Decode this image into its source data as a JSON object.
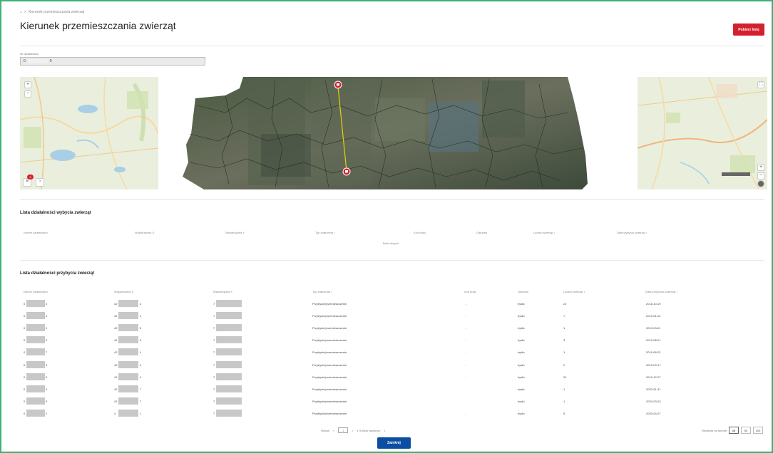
{
  "breadcrumb": {
    "home_icon": "home-icon",
    "separator": ">",
    "current": "Kierunek przemieszczania zwierząt"
  },
  "page": {
    "title": "Kierunek przemieszczania zwierząt",
    "download_label": "Pobierz listę",
    "accent": "#d4202e",
    "primary": "#0b4ea2"
  },
  "filter": {
    "label": "Nr działalności",
    "value_prefix": "0",
    "value_suffix": "0"
  },
  "maps": {
    "left": {
      "zoom_in": "+",
      "zoom_out": "−",
      "badge_count": "2"
    },
    "right": {
      "fullscreen": "⛶",
      "zoom_in": "+",
      "zoom_out": "−"
    },
    "aerial": {
      "marker_top": "⌂",
      "marker_bottom": "⌂"
    }
  },
  "export_section": {
    "title": "Lista działalności wybycia zwierząt",
    "columns": [
      "Numer działalności",
      "Współrzędna X",
      "Współrzędna Y",
      "Typ zdarzenia ↕",
      "Kod kraju",
      "Gatunek",
      "Liczba zwierząt ↕",
      "Data wybycia zwierząt ↕"
    ],
    "empty_message": "Brak danych"
  },
  "import_section": {
    "title": "Lista działalności przybycia zwierząt",
    "columns": [
      "Numer działalności",
      "Współrzędna X",
      "Współrzędna Y",
      "Typ zdarzenia ↕",
      "Kod kraju",
      "Gatunek",
      "Liczba zwierząt ↕",
      "Data przybycia zwierząt ↕"
    ],
    "rows": [
      {
        "id_a": "0",
        "id_b": "0",
        "x_a": "42",
        "x_b": "4",
        "y_a": "7",
        "event": "Przybycie/przemieszczenie",
        "country": "-",
        "species": "bydło",
        "count": "22",
        "date": "2018-10-19"
      },
      {
        "id_a": "0",
        "id_b": "0",
        "x_a": "42",
        "x_b": "4",
        "y_a": "7",
        "event": "Przybycie/przemieszczenie",
        "country": "-",
        "species": "bydło",
        "count": "7",
        "date": "2019-01-24"
      },
      {
        "id_a": "0",
        "id_b": "0",
        "x_a": "42",
        "x_b": "5",
        "y_a": "7",
        "event": "Przybycie/przemieszczenie",
        "country": "-",
        "species": "bydło",
        "count": "1",
        "date": "2019-03-01"
      },
      {
        "id_a": "0",
        "id_b": "0",
        "x_a": "42",
        "x_b": "5",
        "y_a": "7",
        "event": "Przybycie/przemieszczenie",
        "country": "-",
        "species": "bydło",
        "count": "3",
        "date": "2019-08-21"
      },
      {
        "id_a": "0",
        "id_b": "7",
        "x_a": "42",
        "x_b": "4",
        "y_a": "7",
        "event": "Przybycie/przemieszczenie",
        "country": "-",
        "species": "bydło",
        "count": "1",
        "date": "2019-08-22"
      },
      {
        "id_a": "0",
        "id_b": "9",
        "x_a": "42",
        "x_b": "4",
        "y_a": "7",
        "event": "Przybycie/przemieszczenie",
        "country": "-",
        "species": "bydło",
        "count": "2",
        "date": "2019-09-17"
      },
      {
        "id_a": "0",
        "id_b": "0",
        "x_a": "42",
        "x_b": "4",
        "y_a": "7",
        "event": "Przybycie/przemieszczenie",
        "country": "-",
        "species": "bydło",
        "count": "24",
        "date": "2019-12-27"
      },
      {
        "id_a": "0",
        "id_b": "0",
        "x_a": "42",
        "x_b": "7",
        "y_a": "7",
        "event": "Przybycie/przemieszczenie",
        "country": "-",
        "species": "bydło",
        "count": "1",
        "date": "2020-01-31"
      },
      {
        "id_a": "0",
        "id_b": "0",
        "x_a": "42",
        "x_b": "7",
        "y_a": "7",
        "event": "Przybycie/przemieszczenie",
        "country": "-",
        "species": "bydło",
        "count": "1",
        "date": "2020-03-03"
      },
      {
        "id_a": "0",
        "id_b": "2",
        "x_a": "4",
        "x_b": "1",
        "y_a": "7",
        "event": "Przybycie/przemieszczenie",
        "country": "-",
        "species": "bydło",
        "count": "5",
        "date": "2020-04-07"
      }
    ]
  },
  "pagination": {
    "page_label": "Strona",
    "prev": "<",
    "current_page": "1",
    "next": ">",
    "of_label": "z 3 (ilość wyników:",
    "results_suffix": ")",
    "per_page_label": "Wyników na stronie",
    "per_page_options": [
      "10",
      "50",
      "100"
    ],
    "selected_per_page": "10"
  },
  "footer": {
    "close_label": "Zamknij"
  }
}
